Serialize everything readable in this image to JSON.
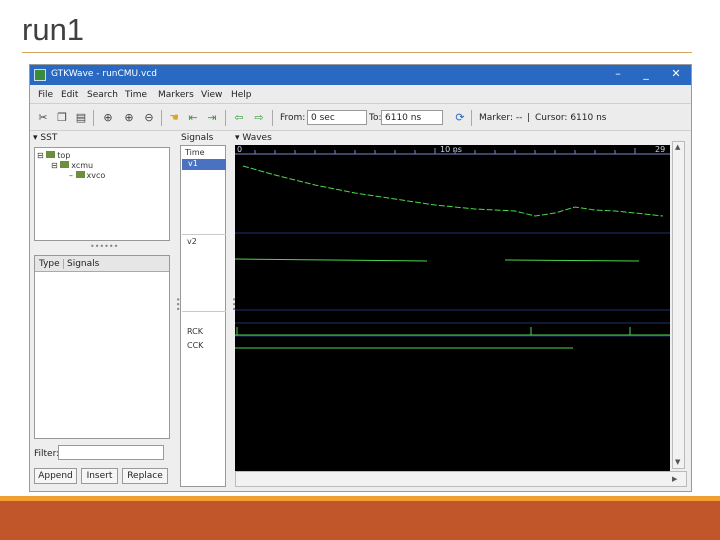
{
  "slide": {
    "title": "run1"
  },
  "window": {
    "title": "GTKWave - runCMU.vcd",
    "controls": {
      "minimize": "–",
      "maximize": "_",
      "close": "✕"
    }
  },
  "menu": [
    "File",
    "Edit",
    "Search",
    "Time",
    "Markers",
    "View",
    "Help"
  ],
  "toolbar": {
    "from_label": "From:",
    "from_value": "0 sec",
    "to_label": "To:",
    "to_value": "6110 ns",
    "marker_text": "Marker: --",
    "separator": "|",
    "cursor_text": "Cursor: 6110 ns",
    "icons": [
      "cut-icon",
      "copy-icon",
      "paste-icon",
      "zoom-fit-icon",
      "zoom-in-icon",
      "zoom-out-icon",
      "hand-icon",
      "jump-start-icon",
      "jump-end-icon",
      "arrow-left-icon",
      "arrow-right-icon",
      "reload-icon"
    ]
  },
  "sst": {
    "label": "SST",
    "tree": [
      "top",
      "xcmu",
      "xvco"
    ],
    "type_header": "Type",
    "signals_header": "Signals",
    "filter_label": "Filter:",
    "buttons": {
      "append": "Append",
      "insert": "Insert",
      "replace": "Replace"
    }
  },
  "signals_pane": {
    "label": "Signals",
    "time_label": "Time",
    "rows": [
      "v1",
      "v2",
      "RCK",
      "CCK"
    ]
  },
  "waves_pane": {
    "label": "Waves",
    "ruler_start": "0",
    "ruler_mid": "10 ns",
    "ruler_end": "29",
    "colors": {
      "background": "#000000",
      "trace": "#4cd84c",
      "grid": "#1f2f6a",
      "ruler": "#7a88c8"
    }
  }
}
